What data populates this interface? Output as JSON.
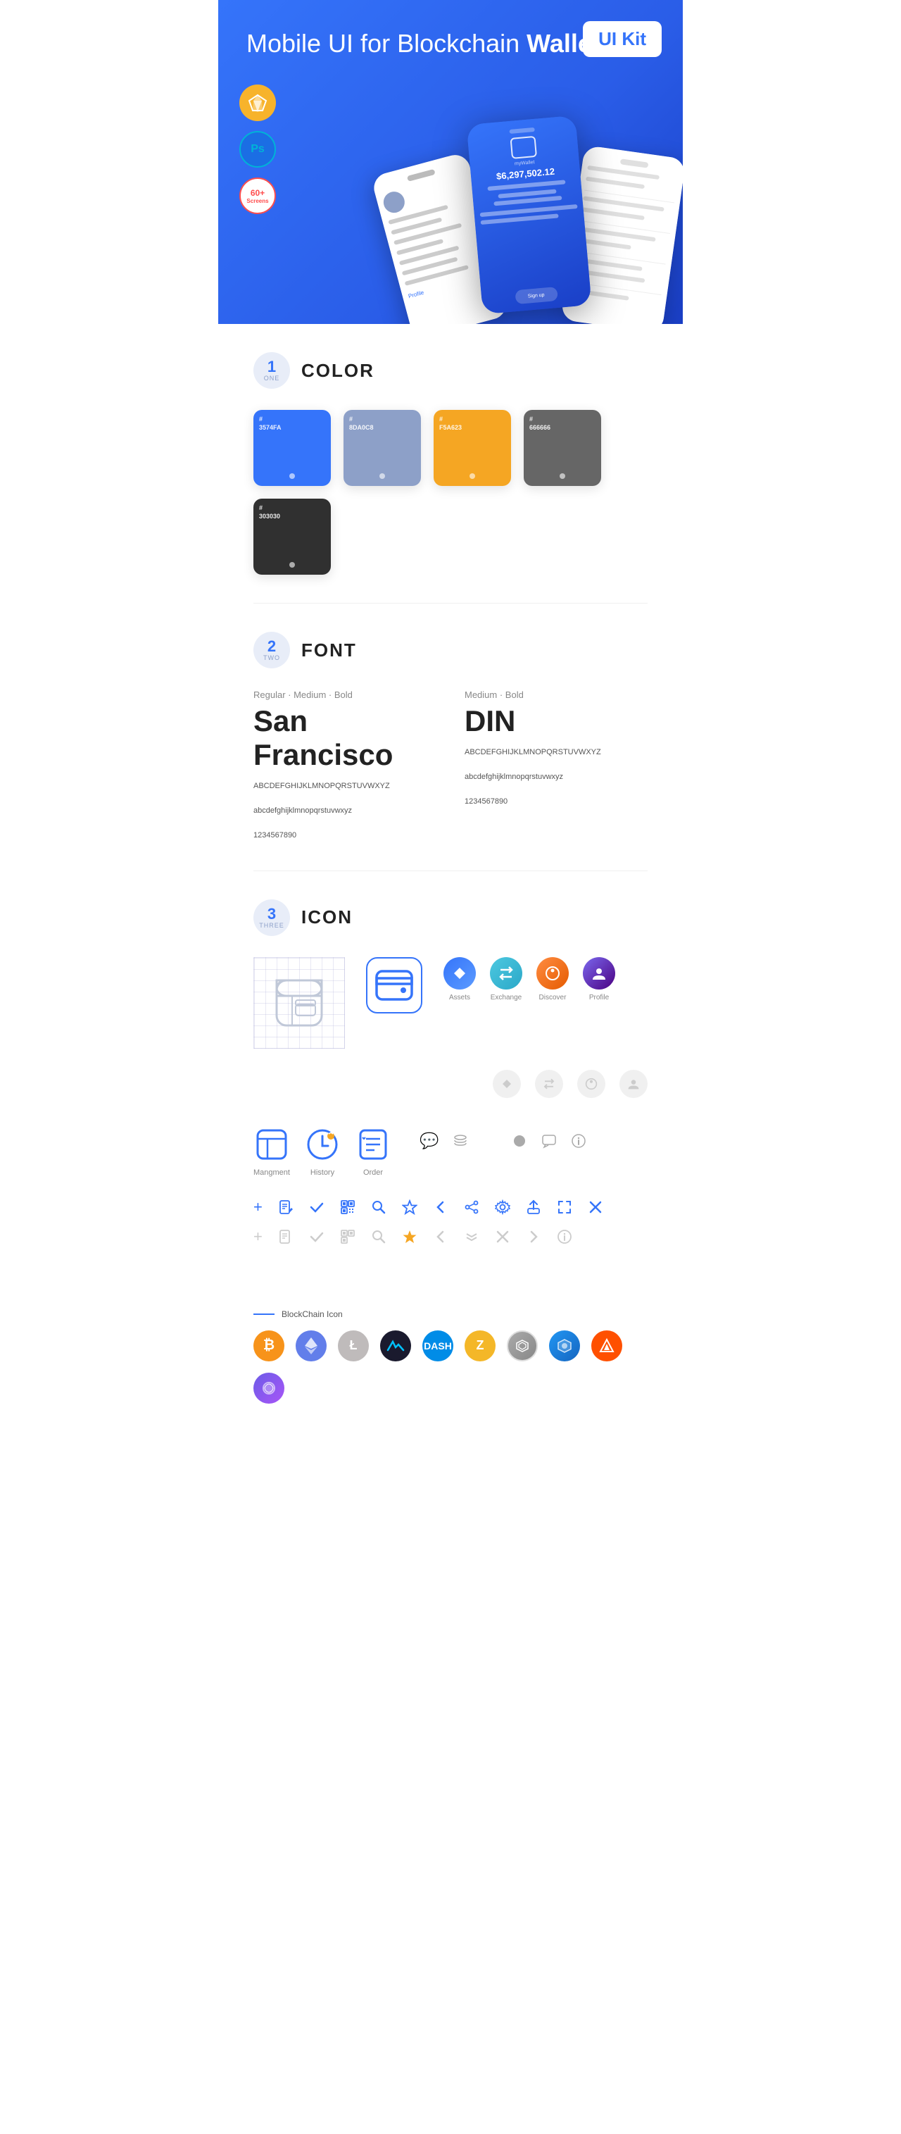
{
  "hero": {
    "title": "Mobile UI for Blockchain ",
    "title_bold": "Wallet",
    "badge": "UI Kit",
    "icons": [
      {
        "name": "Sketch",
        "label": "Sk"
      },
      {
        "name": "Photoshop",
        "label": "Ps"
      },
      {
        "name": "Screens",
        "label": "60+\nScreens"
      }
    ]
  },
  "sections": {
    "color": {
      "num": "1",
      "word": "ONE",
      "title": "COLOR",
      "swatches": [
        {
          "hex": "#3574FA",
          "label": "#\n3574FA",
          "dot_color": "rgba(255,255,255,0.6)"
        },
        {
          "hex": "#8DA0C8",
          "label": "#\n8DA0C8",
          "dot_color": "rgba(255,255,255,0.6)"
        },
        {
          "hex": "#F5A623",
          "label": "#\nF5A623",
          "dot_color": "rgba(255,255,255,0.6)"
        },
        {
          "hex": "#666666",
          "label": "#\n666666",
          "dot_color": "rgba(255,255,255,0.6)"
        },
        {
          "hex": "#303030",
          "label": "#\n303030",
          "dot_color": "rgba(255,255,255,0.6)"
        }
      ]
    },
    "font": {
      "num": "2",
      "word": "TWO",
      "title": "FONT",
      "fonts": [
        {
          "style": "Regular · Medium · Bold",
          "name": "San Francisco",
          "upper": "ABCDEFGHIJKLMNOPQRSTUVWXYZ",
          "lower": "abcdefghijklmnopqrstuvwxyz",
          "nums": "1234567890"
        },
        {
          "style": "Medium · Bold",
          "name": "DIN",
          "upper": "ABCDEFGHIJKLMNOPQRSTUVWXYZ",
          "lower": "abcdefghijklmnopqrstuvwxyz",
          "nums": "1234567890"
        }
      ]
    },
    "icon": {
      "num": "3",
      "word": "THREE",
      "title": "ICON",
      "nav_icons": [
        {
          "label": "Assets",
          "color": "blue"
        },
        {
          "label": "Exchange",
          "color": "teal"
        },
        {
          "label": "Discover",
          "color": "orange"
        },
        {
          "label": "Profile",
          "color": "purple"
        }
      ],
      "mgmt_icons": [
        {
          "label": "Mangment"
        },
        {
          "label": "History"
        },
        {
          "label": "Order"
        }
      ],
      "blockchain_label": "BlockChain Icon",
      "crypto_coins": [
        "BTC",
        "ETH",
        "LTC",
        "WAVES",
        "DASH",
        "ZEC",
        "XLM",
        "QTUM",
        "XRP",
        "POWR"
      ]
    }
  }
}
